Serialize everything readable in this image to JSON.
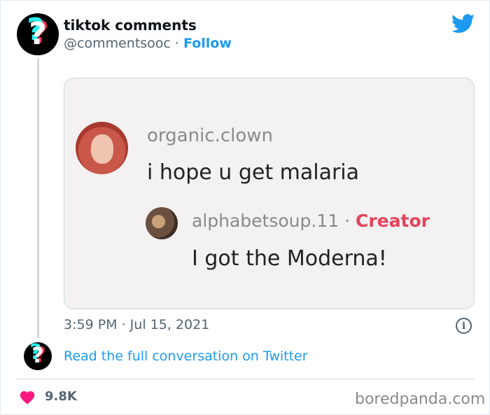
{
  "tweet": {
    "author_name": "tiktok comments",
    "author_handle": "@commentsooc",
    "separator": " · ",
    "follow_label": "Follow",
    "timestamp": "3:59 PM · Jul 15, 2021",
    "read_link": "Read the full conversation on Twitter",
    "likes": "9.8K",
    "avatar_glyph": "?"
  },
  "embedded_image": {
    "comment1": {
      "user": "organic.clown",
      "text": "i hope u get malaria"
    },
    "comment2": {
      "user": "alphabetsoup.11",
      "separator": " · ",
      "badge": "Creator",
      "text": "I got the Moderna!"
    }
  },
  "watermark": "boredpanda.com",
  "icons": {
    "bird": "twitter-bird-icon",
    "info": "info-icon",
    "heart": "heart-icon"
  },
  "colors": {
    "link": "#1d9bf0",
    "heart": "#f91880",
    "creator_badge": "#e2445c",
    "muted": "#536471"
  }
}
